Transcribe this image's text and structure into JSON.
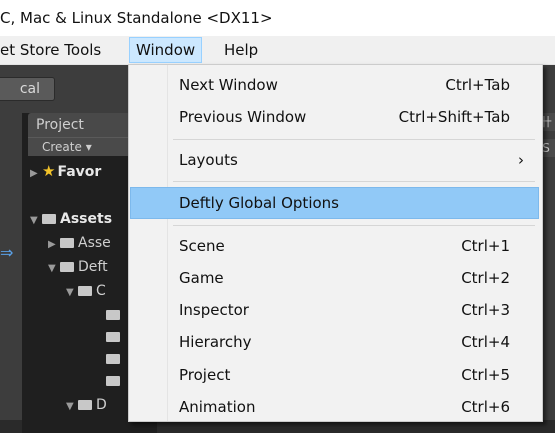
{
  "window": {
    "title": "C, Mac & Linux Standalone <DX11>"
  },
  "menubar": {
    "items": [
      {
        "label": "et Store Tools"
      },
      {
        "label": "Window"
      },
      {
        "label": "Help"
      }
    ]
  },
  "editor": {
    "local_button": "cal",
    "project_tab": "Project",
    "create_button": "Create ▾",
    "side_labels": [
      "卄",
      "S"
    ],
    "tree": [
      {
        "label": "Favor"
      },
      {
        "label": "Assets"
      },
      {
        "label": "Asse"
      },
      {
        "label": "Deft"
      },
      {
        "label": "C"
      },
      {
        "label": "D"
      }
    ]
  },
  "window_menu": {
    "items": [
      {
        "label": "Next Window",
        "shortcut": "Ctrl+Tab"
      },
      {
        "label": "Previous Window",
        "shortcut": "Ctrl+Shift+Tab"
      },
      {
        "label": "Layouts",
        "shortcut": "›"
      },
      {
        "label": "Deftly Global Options",
        "shortcut": ""
      },
      {
        "label": "Scene",
        "shortcut": "Ctrl+1"
      },
      {
        "label": "Game",
        "shortcut": "Ctrl+2"
      },
      {
        "label": "Inspector",
        "shortcut": "Ctrl+3"
      },
      {
        "label": "Hierarchy",
        "shortcut": "Ctrl+4"
      },
      {
        "label": "Project",
        "shortcut": "Ctrl+5"
      },
      {
        "label": "Animation",
        "shortcut": "Ctrl+6"
      }
    ],
    "highlighted": "Deftly Global Options"
  },
  "colors": {
    "highlight": "#91c9f7",
    "menu_bg": "#f2f2f2",
    "editor_bg": "#3d3d3d"
  }
}
